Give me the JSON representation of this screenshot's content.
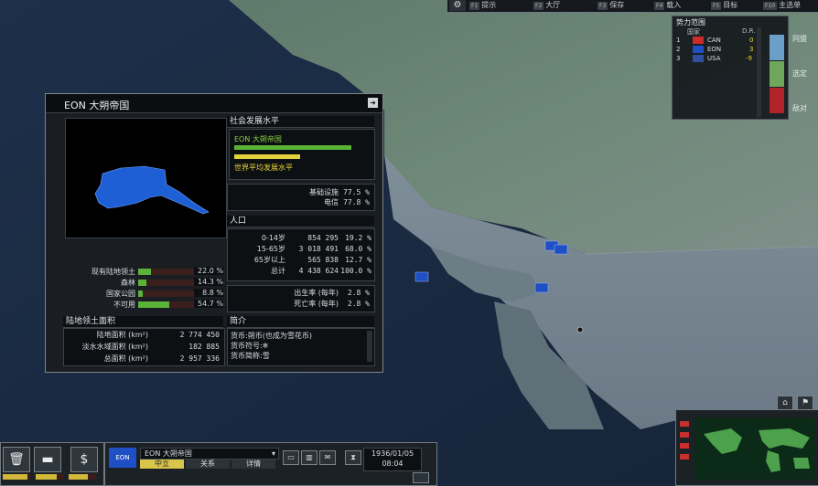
{
  "toolbar": {
    "items": [
      {
        "key": "F1",
        "label": "提示"
      },
      {
        "key": "F2",
        "label": "大厅"
      },
      {
        "key": "F3",
        "label": "保存"
      },
      {
        "key": "F4",
        "label": "载入"
      },
      {
        "key": "F5",
        "label": "目标"
      },
      {
        "key": "F10",
        "label": "主选单"
      }
    ],
    "gear_icon": "gear-icon"
  },
  "sphere": {
    "title": "势力范围",
    "col_country": "国家",
    "col_dr": "D.R.",
    "rows": [
      {
        "rank": "1",
        "name": "CAN",
        "dr": "0",
        "dr_color": "#e8d43a",
        "flag_color": "#cc2b2b"
      },
      {
        "rank": "2",
        "name": "EON",
        "dr": "3",
        "dr_color": "#e8d43a",
        "flag_color": "#1e4fc4"
      },
      {
        "rank": "3",
        "name": "USA",
        "dr": "-9",
        "dr_color": "#e8d43a",
        "flag_color": "#2f4f9f"
      }
    ],
    "legend": [
      {
        "label": "同盟",
        "color": "#6c9fc8"
      },
      {
        "label": "选定",
        "color": "#6fa85a"
      },
      {
        "label": "敌对",
        "color": "#b3242a"
      }
    ]
  },
  "country_window": {
    "title": "EON 大朔帝国",
    "land": {
      "rows": [
        {
          "label": "现有陆地领土",
          "pct": "22.0 %",
          "fill": 0.22
        },
        {
          "label": "森林",
          "pct": "14.3 %",
          "fill": 0.143
        },
        {
          "label": "国家公园",
          "pct": "8.8 %",
          "fill": 0.088
        },
        {
          "label": "不可用",
          "pct": "54.7 %",
          "fill": 0.547
        }
      ]
    },
    "area": {
      "header": "陆地领土面积",
      "rows": [
        {
          "label": "陆地面积 (km²)",
          "value": "2 774 450"
        },
        {
          "label": "淡水水域面积 (km²)",
          "value": "182 885"
        },
        {
          "label": "总面积 (km²)",
          "value": "2 957 336"
        }
      ]
    },
    "social": {
      "header": "社会发展水平",
      "nation_label": "EON 大朔帝国",
      "nation_fill": 0.8,
      "world_label": "世界平均发展水平",
      "world_fill": 0.45,
      "rows": [
        {
          "label": "基础设施",
          "value": "77.5 %"
        },
        {
          "label": "电信",
          "value": "77.8 %"
        }
      ]
    },
    "population": {
      "header": "人口",
      "rows": [
        {
          "label": "0-14岁",
          "value": "854 295",
          "pct": "19.2 %"
        },
        {
          "label": "15-65岁",
          "value": "3 018 491",
          "pct": "68.0 %"
        },
        {
          "label": "65岁以上",
          "value": "565 838",
          "pct": "12.7 %"
        },
        {
          "label": "总计",
          "value": "4 438 624",
          "pct": "100.0 %"
        }
      ],
      "rates": [
        {
          "label": "出生率 (每年)",
          "value": "2.8 %"
        },
        {
          "label": "死亡率 (每年)",
          "value": "2.8 %"
        }
      ]
    },
    "summary": {
      "header": "简介",
      "lines": [
        "货币:朔币(也成为雪花币)",
        "货币符号:❄",
        "货币简称:雪"
      ]
    }
  },
  "bottom": {
    "country": "EON 大朔帝国",
    "flag_text": "EON",
    "tabs": [
      "中立",
      "关系",
      "详情"
    ],
    "date": "1936/01/05",
    "time": "08:04",
    "meters": [
      0.9,
      0.75,
      0.7
    ]
  }
}
